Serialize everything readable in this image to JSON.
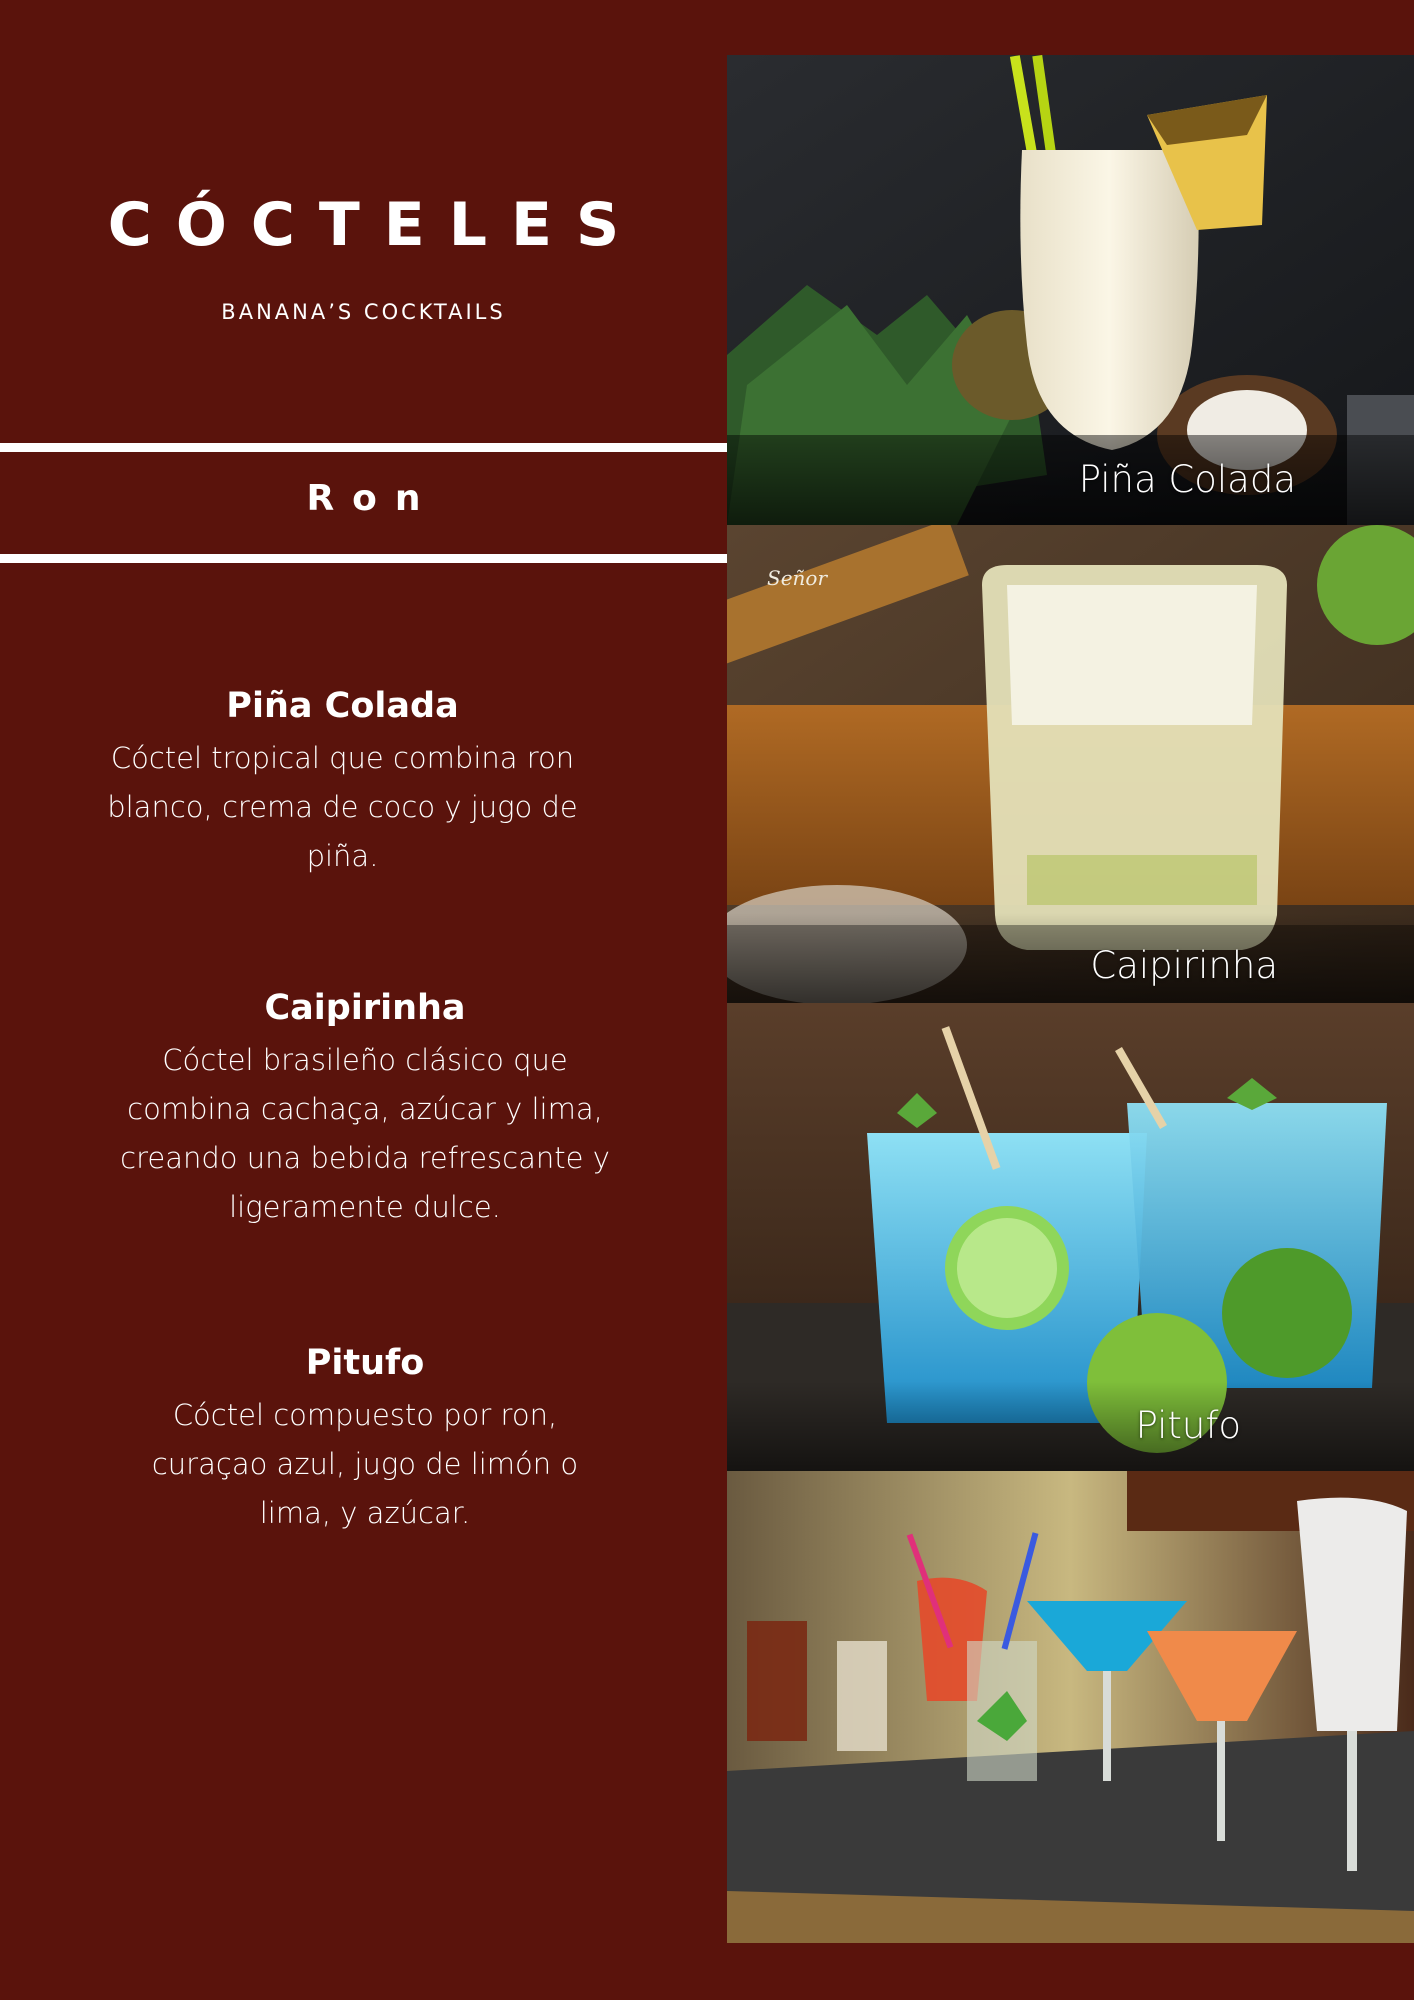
{
  "header": {
    "title": "CÓCTELES",
    "subtitle": "BANANA’S COCKTAILS"
  },
  "section": {
    "label": "Ron"
  },
  "menu": {
    "items": [
      {
        "name": "Piña Colada",
        "description": "Cóctel tropical que combina ron blanco, crema de coco y jugo de piña."
      },
      {
        "name": "Caipirinha",
        "description": "Cóctel brasileño clásico que combina cachaça, azúcar y lima, creando una bebida refrescante y ligeramente dulce."
      },
      {
        "name": "Pitufo",
        "description": "Cóctel compuesto por ron, curaçao azul, jugo de limón o lima, y azúcar."
      }
    ]
  },
  "photos": {
    "captions": [
      "Piña Colada",
      "Caipirinha",
      "Pitufo"
    ]
  },
  "colors": {
    "background": "#5a130c",
    "text": "#ffffff"
  }
}
